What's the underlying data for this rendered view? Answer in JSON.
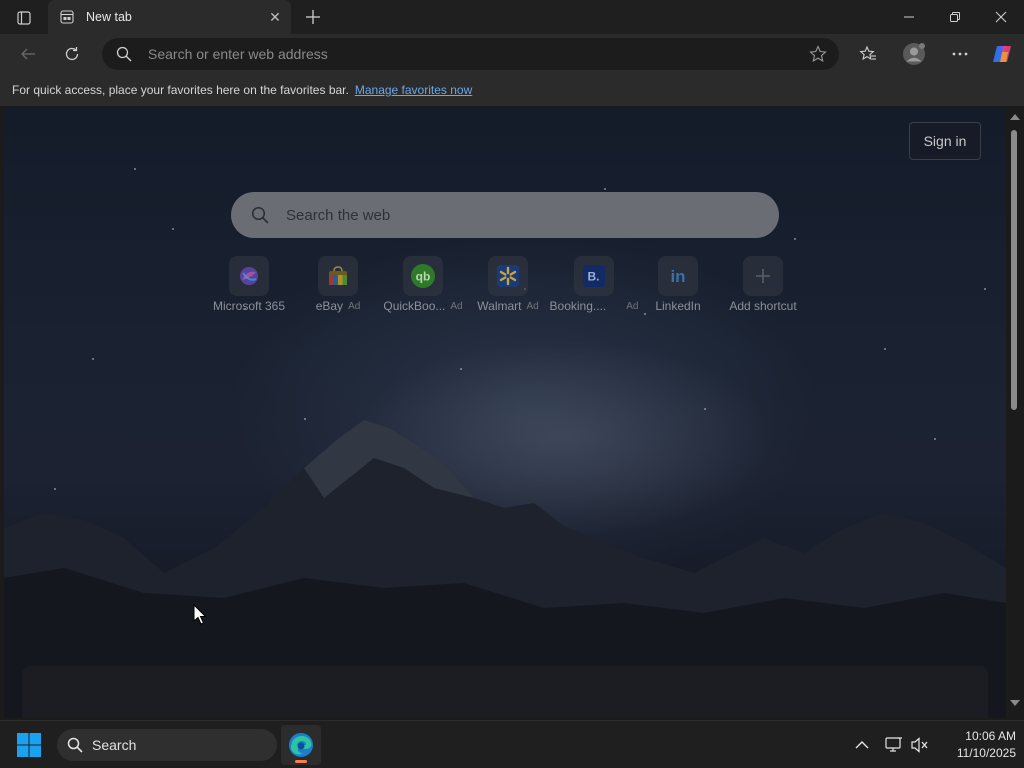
{
  "tab": {
    "title": "New tab",
    "close_glyph": "✕"
  },
  "toolbar": {
    "address_placeholder": "Search or enter web address"
  },
  "favorites_bar": {
    "message": "For quick access, place your favorites here on the favorites bar.",
    "link": "Manage favorites now"
  },
  "new_tab_page": {
    "sign_in": "Sign in",
    "search_placeholder": "Search the web",
    "shortcuts": [
      {
        "label": "Microsoft 365",
        "ad": "",
        "icon": "microsoft-365-icon"
      },
      {
        "label": "eBay",
        "ad": "Ad",
        "icon": "ebay-icon"
      },
      {
        "label": "QuickBoo...",
        "ad": "Ad",
        "icon": "quickbooks-icon"
      },
      {
        "label": "Walmart",
        "ad": "Ad",
        "icon": "walmart-icon"
      },
      {
        "label": "Booking....",
        "ad": "Ad",
        "icon": "booking-icon"
      },
      {
        "label": "LinkedIn",
        "ad": "",
        "icon": "linkedin-icon"
      },
      {
        "label": "Add shortcut",
        "ad": "",
        "icon": "add-icon"
      }
    ]
  },
  "taskbar": {
    "search_label": "Search",
    "time": "10:06 AM",
    "date": "11/10/2025"
  },
  "colors": {
    "accent_link": "#6aa8e8",
    "taskbar_indicator": "#ff7d4a",
    "windows_blue": "#1aa2f0"
  }
}
